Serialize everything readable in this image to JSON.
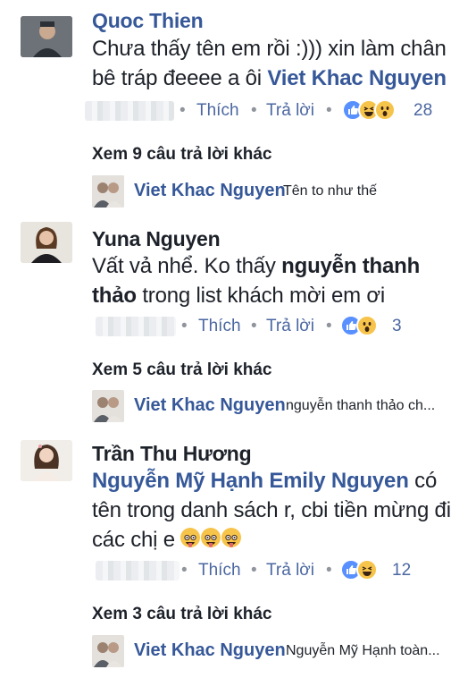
{
  "comments": [
    {
      "name": "Quoc Thien",
      "text_parts": [
        "Chưa thấy tên em rồi :))) xin làm chân bê tráp đeeee a ôi ",
        "Viet Khac Nguyen"
      ],
      "like_label": "Thích",
      "reply_label": "Trả lời",
      "reaction_count": "28",
      "more_replies": "Xem 9 câu trả lời khác",
      "reply": {
        "name": "Viet Khac Nguyen",
        "text": "Tên to như thế"
      }
    },
    {
      "name": "Yuna Nguyen",
      "text_parts": [
        "Vất vả nhể. Ko thấy ",
        "nguyễn thanh thảo",
        " trong list khách mời em ơi"
      ],
      "like_label": "Thích",
      "reply_label": "Trả lời",
      "reaction_count": "3",
      "more_replies": "Xem 5 câu trả lời khác",
      "reply": {
        "name": "Viet Khac Nguyen",
        "text": "nguyễn thanh thảo  ch..."
      }
    },
    {
      "name": "Trần Thu Hương",
      "text_parts": [
        "Nguyễn Mỹ Hạnh",
        " ",
        "Emily Nguyen",
        " có tên trong danh sách r, cbi tiền mừng đi các chị e "
      ],
      "like_label": "Thích",
      "reply_label": "Trả lời",
      "reaction_count": "12",
      "more_replies": "Xem 3 câu trả lời khác",
      "reply": {
        "name": "Viet Khac Nguyen",
        "text": "Nguyễn Mỹ Hạnh  toàn..."
      }
    }
  ],
  "icons": {
    "reactions_1": [
      "like",
      "haha",
      "wow"
    ],
    "reactions_2": [
      "like",
      "wow"
    ],
    "reactions_3": [
      "like",
      "haha"
    ],
    "inline_emoji": "tongue-out-face"
  },
  "colors": {
    "name": "#365899",
    "text": "#1d2129",
    "meta": "#90949c",
    "action": "#4b67a1",
    "like": "#5890ff",
    "emoji": "#f7c44b"
  }
}
